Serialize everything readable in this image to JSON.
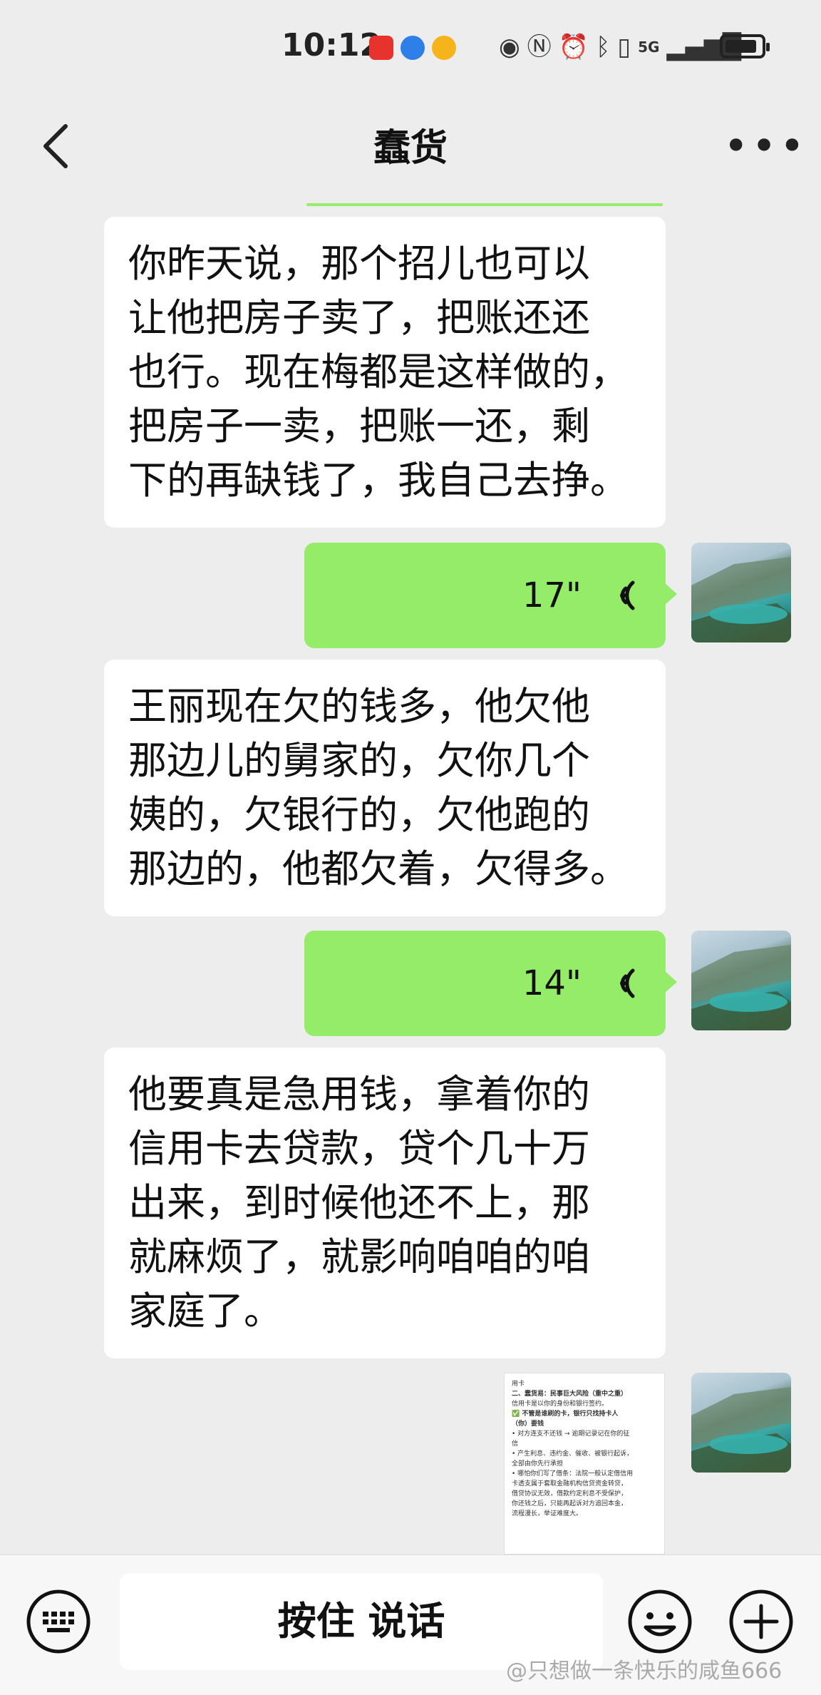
{
  "status": {
    "time": "10:12",
    "network": "5G",
    "battery_level": 0.9,
    "icons": [
      "huawei-app-icon",
      "browser-icon",
      "weibo-icon",
      "eye-icon",
      "nfc-icon",
      "alarm-icon",
      "bluetooth-icon",
      "vibrate-icon",
      "signal-icon",
      "battery-icon"
    ]
  },
  "header": {
    "title": "蠢货"
  },
  "messages": [
    {
      "side": "left",
      "type": "text",
      "lines": [
        "你昨天说，那个招儿也可以",
        "让他把房子卖了，把账还还",
        "也行。现在梅都是这样做的，",
        "把房子一卖，把账一还，剩",
        "下的再缺钱了，我自己去挣。"
      ]
    },
    {
      "side": "right",
      "type": "voice",
      "duration": "17\""
    },
    {
      "side": "left",
      "type": "text",
      "lines": [
        "王丽现在欠的钱多，他欠他",
        "那边儿的舅家的，欠你几个",
        "姨的，欠银行的，欠他跑的",
        "那边的，他都欠着，欠得多。"
      ]
    },
    {
      "side": "right",
      "type": "voice",
      "duration": "14\""
    },
    {
      "side": "left",
      "type": "text",
      "lines": [
        "他要真是急用钱，拿着你的",
        "信用卡去贷款，贷个几十万",
        "出来，到时候他还不上，那",
        "就麻烦了，就影响咱咱的咱",
        "家庭了。"
      ]
    },
    {
      "side": "right",
      "type": "image",
      "doc_lines": [
        "用卡",
        "二、蠢货易：民事巨大风险（重中之重）",
        "信用卡是以你的身份和银行签约。",
        "✅ 不管是谁刷的卡，银行只找持卡人",
        "（你）要钱",
        "• 对方连支不还钱 → 逾期记录记在你的征",
        "  信",
        "• 产生利息、违约金、催收、被银行起诉，",
        "  全部由你先行承担",
        "• 哪怕你们写了借条：法院一般认定借信用",
        "  卡透支属于套取金融机构信贷资金转贷，",
        "  借贷协议无效，借款约定利息不受保护，",
        "  你还钱之后，只能再起诉对方追回本金，",
        "  流程漫长，举证难度大。"
      ]
    }
  ],
  "input_bar": {
    "hold_to_talk": "按住 说话"
  },
  "watermark": "@只想做一条快乐的咸鱼666"
}
